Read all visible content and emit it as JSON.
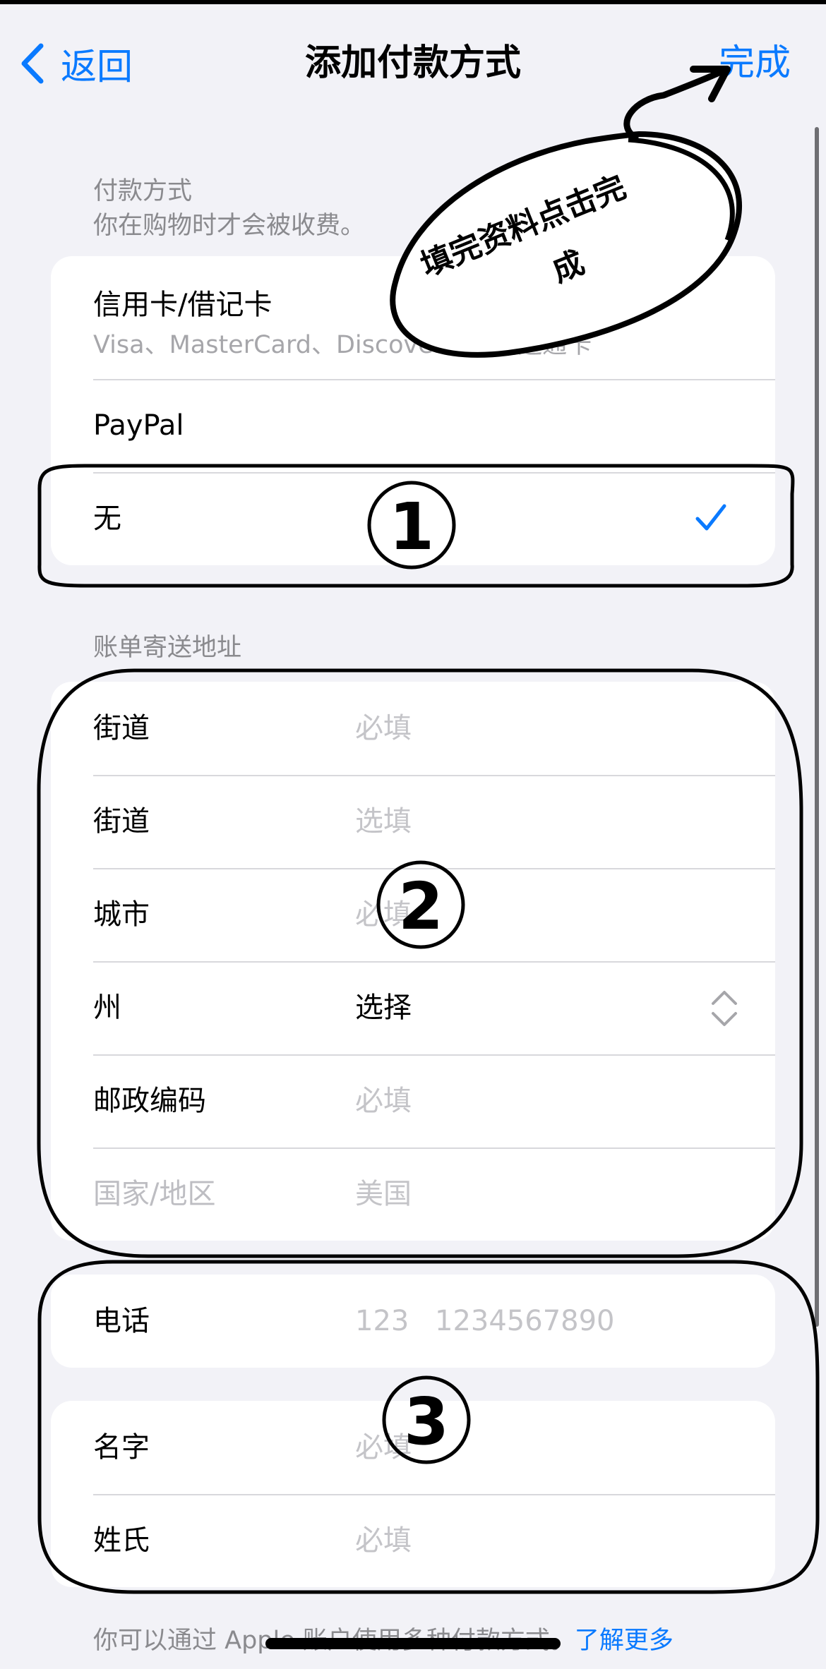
{
  "nav": {
    "back_label": "返回",
    "title": "添加付款方式",
    "done_label": "完成"
  },
  "payment": {
    "header": "付款方式",
    "subheader": "你在购物时才会被收费。",
    "card_title": "信用卡/借记卡",
    "card_networks": "Visa、MasterCard、Discover、美国运通卡",
    "paypal_label": "PayPal",
    "none_label": "无"
  },
  "billing": {
    "header": "账单寄送地址",
    "rows": [
      {
        "label": "街道",
        "value": "必填"
      },
      {
        "label": "街道",
        "value": "选填"
      },
      {
        "label": "城市",
        "value": "必填"
      },
      {
        "label": "州",
        "value": "选择"
      },
      {
        "label": "邮政编码",
        "value": "必填"
      },
      {
        "label": "国家/地区",
        "value": "美国"
      }
    ]
  },
  "phone": {
    "label": "电话",
    "area_placeholder": "123",
    "number_placeholder": "1234567890"
  },
  "name": {
    "first_label": "名字",
    "first_placeholder": "必填",
    "last_label": "姓氏",
    "last_placeholder": "必填"
  },
  "footer": {
    "text": "你可以通过 Apple 账户使用多种付款方式。",
    "link": "了解更多"
  },
  "annotations": {
    "callout_line1": "填完资料点击完",
    "callout_line2": "成",
    "marker_1": "①",
    "marker_2": "②",
    "marker_3": "③"
  },
  "colors": {
    "accent": "#0a7aff",
    "background": "#f2f2f7",
    "secondary_text": "#8a8a8e",
    "placeholder": "#c4c4c8"
  }
}
